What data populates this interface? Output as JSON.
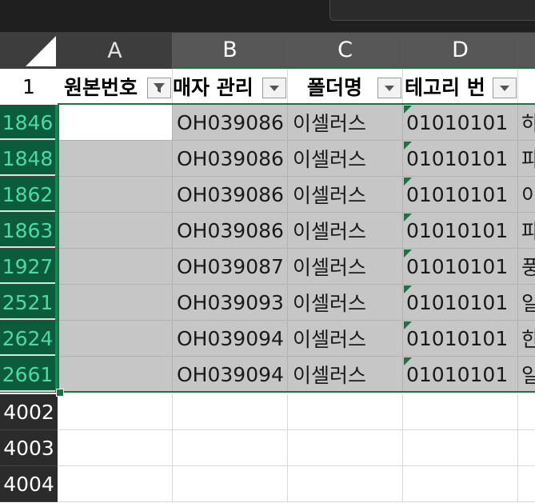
{
  "columns": [
    "A",
    "B",
    "C",
    "D"
  ],
  "header_row_number": "1",
  "header_cells": {
    "a": "원본번호",
    "b": "매자 관리",
    "c": "폴더명",
    "d": "테고리 번"
  },
  "rows": [
    {
      "num": "1846",
      "b": "OH039086",
      "c": "이셀러스 ",
      "d": "01010101",
      "e": "하"
    },
    {
      "num": "1848",
      "b": "OH039086",
      "c": "이셀러스 ",
      "d": "01010101",
      "e": "파"
    },
    {
      "num": "1862",
      "b": "OH039086",
      "c": "이셀러스 ",
      "d": "01010101",
      "e": "이"
    },
    {
      "num": "1863",
      "b": "OH039086",
      "c": "이셀러스 ",
      "d": "01010101",
      "e": "파"
    },
    {
      "num": "1927",
      "b": "OH039087",
      "c": "이셀러스 ",
      "d": "01010101",
      "e": "풍"
    },
    {
      "num": "2521",
      "b": "OH039093",
      "c": "이셀러스 ",
      "d": "01010101",
      "e": "일"
    },
    {
      "num": "2624",
      "b": "OH039094",
      "c": "이셀러스 ",
      "d": "01010101",
      "e": "한"
    },
    {
      "num": "2661",
      "b": "OH039094",
      "c": "이셀러스 ",
      "d": "01010101",
      "e": "일"
    }
  ],
  "empty_rows": [
    "4002",
    "4003",
    "4004"
  ],
  "colors": {
    "selection_green": "#1e7145",
    "selected_range": "#c6c6c6",
    "header_dark": "#3d3d3d"
  }
}
